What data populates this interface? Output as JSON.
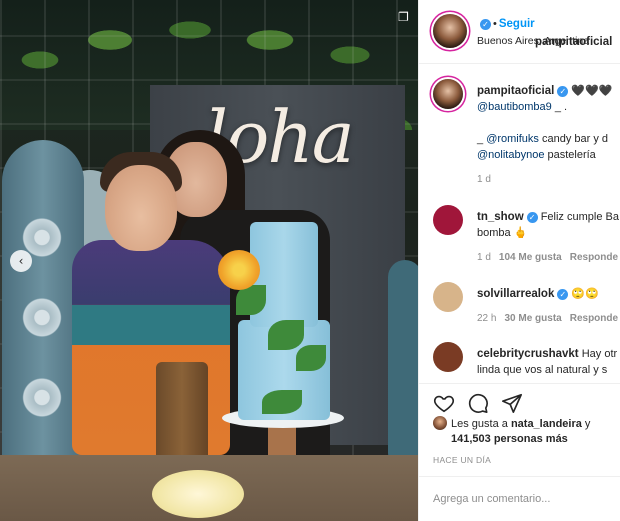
{
  "photo": {
    "sign_text": "loha",
    "carousel_prev_symbol": "‹",
    "collage_symbol": "❐"
  },
  "post": {
    "author": "pampitaoficial",
    "follow_label": "Seguir",
    "location": "Buenos Aires, Argentina",
    "caption": {
      "hearts": "🖤🖤🖤",
      "line1_mention": "@bautibomba9",
      "line1_rest": " _ .",
      "line2_prefix": "_ ",
      "line2_mention": "@romifuks",
      "line2_rest": " candy bar y d",
      "line3_mention": "@nolitabynoe",
      "line3_rest": " pastelería",
      "time": "1 d"
    }
  },
  "comments": [
    {
      "user": "tn_show",
      "text_line1": "Feliz cumple Ba",
      "text_line2": "bomba 🖕",
      "time": "1 d",
      "likes": "104 Me gusta",
      "reply": "Responde",
      "avatar_color": "#a0163a"
    },
    {
      "user": "solvillarrealok",
      "text_line1": "🙄🙄",
      "time": "22 h",
      "likes": "30 Me gusta",
      "reply": "Responde",
      "avatar_color": "#d7b48a"
    },
    {
      "user": "celebritycrushavkt",
      "text_line1": "Hay otr",
      "text_line2": "linda que vos al natural y s",
      "avatar_color": "#7a3b24"
    }
  ],
  "actions": {
    "likes_prefix": "Les gusta a ",
    "likes_user": "nata_landeira",
    "likes_conj": " y",
    "likes_count": "141,503 personas más",
    "timestamp": "HACE UN DÍA"
  },
  "comment_box": {
    "placeholder": "Agrega un comentario..."
  },
  "colors": {
    "link_blue": "#0095f6",
    "verified_blue": "#3897f0",
    "mention_blue": "#00376b",
    "muted": "#8e8e8e"
  }
}
